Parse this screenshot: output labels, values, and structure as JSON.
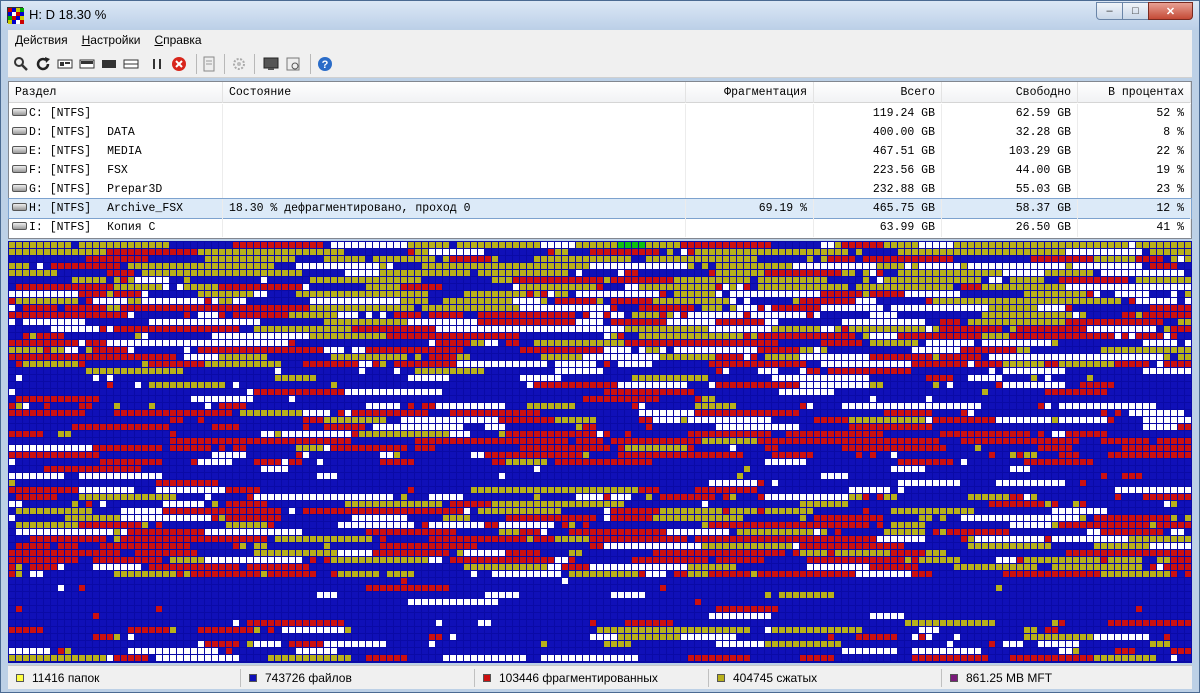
{
  "window": {
    "title": "H: D  18.30 %"
  },
  "menu": [
    "Действия",
    "Настройки",
    "Справка"
  ],
  "toolbar": [
    "search-icon",
    "refresh-icon",
    "analyze-icon",
    "defrag-icon",
    "quick-optimize-icon",
    "full-optimize-icon",
    "pause-icon",
    "stop-icon",
    "report-icon",
    "settings-icon",
    "boot-time-icon",
    "log-icon",
    "help-icon"
  ],
  "table": {
    "headers": [
      "Раздел",
      "Состояние",
      "Фрагментация",
      "Всего",
      "Свободно",
      "В процентах"
    ],
    "rows": [
      {
        "drive": "C: [NTFS]",
        "label": "",
        "status": "",
        "frag": "",
        "total": "119.24 GB",
        "free": "62.59 GB",
        "percent": "52 %"
      },
      {
        "drive": "D: [NTFS]",
        "label": "DATA",
        "status": "",
        "frag": "",
        "total": "400.00 GB",
        "free": "32.28 GB",
        "percent": "8 %"
      },
      {
        "drive": "E: [NTFS]",
        "label": "MEDIA",
        "status": "",
        "frag": "",
        "total": "467.51 GB",
        "free": "103.29 GB",
        "percent": "22 %"
      },
      {
        "drive": "F: [NTFS]",
        "label": "FSX",
        "status": "",
        "frag": "",
        "total": "223.56 GB",
        "free": "44.00 GB",
        "percent": "19 %"
      },
      {
        "drive": "G: [NTFS]",
        "label": "Prepar3D",
        "status": "",
        "frag": "",
        "total": "232.88 GB",
        "free": "55.03 GB",
        "percent": "23 %"
      },
      {
        "drive": "H: [NTFS]",
        "label": "Archive_FSX",
        "status": "18.30 % дефрагментировано, проход 0",
        "frag": "69.19 %",
        "total": "465.75 GB",
        "free": "58.37 GB",
        "percent": "12 %"
      },
      {
        "drive": "I: [NTFS]",
        "label": "Копия C",
        "status": "",
        "frag": "",
        "total": "63.99 GB",
        "free": "26.50 GB",
        "percent": "41 %"
      }
    ],
    "selected_row": 5
  },
  "map_colors": {
    "background": "#0a0aa6",
    "free": "#ffffff",
    "fragmented": "#cc1010",
    "compressed": "#b8b01a",
    "file": "#1010b8",
    "mft": "#7a1a7a",
    "processing": "#10c010"
  },
  "status": [
    {
      "text": "11416 папок",
      "color": "#ffff40"
    },
    {
      "text": "743726 файлов",
      "color": "#1010b8"
    },
    {
      "text": "103446 фрагментированных",
      "color": "#cc1010"
    },
    {
      "text": "404745 сжатых",
      "color": "#b8b01a"
    },
    {
      "text": "861.25 MB MFT",
      "color": "#7a1a7a"
    }
  ]
}
